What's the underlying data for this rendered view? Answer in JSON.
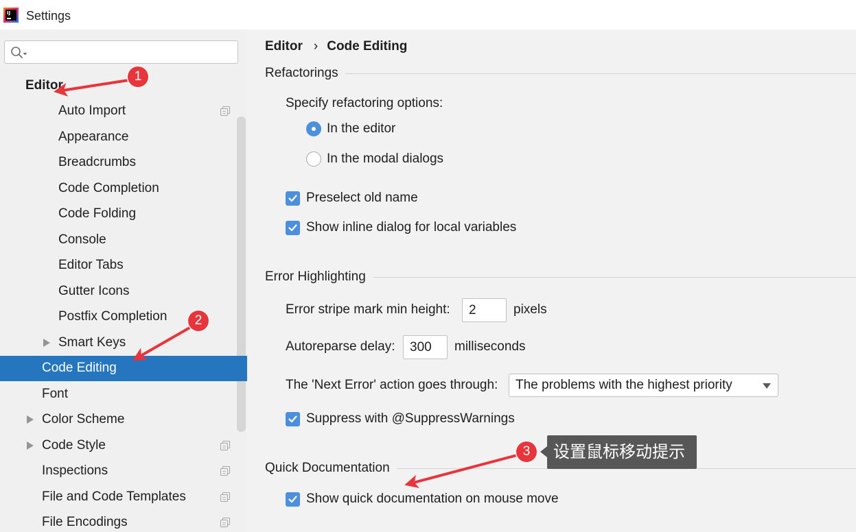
{
  "window": {
    "logo_text": "IJ",
    "title": "Settings"
  },
  "search": {
    "icon": "search-icon",
    "value": "",
    "placeholder": ""
  },
  "sidebar": {
    "items": [
      {
        "label": "Editor",
        "selected": false,
        "expandable": false
      },
      {
        "label": "Auto Import",
        "selected": false,
        "expandable": false,
        "icon": "project-scope-icon"
      },
      {
        "label": "Appearance",
        "selected": false,
        "expandable": false
      },
      {
        "label": "Breadcrumbs",
        "selected": false,
        "expandable": false
      },
      {
        "label": "Code Completion",
        "selected": false,
        "expandable": false
      },
      {
        "label": "Code Folding",
        "selected": false,
        "expandable": false
      },
      {
        "label": "Console",
        "selected": false,
        "expandable": false
      },
      {
        "label": "Editor Tabs",
        "selected": false,
        "expandable": false
      },
      {
        "label": "Gutter Icons",
        "selected": false,
        "expandable": false
      },
      {
        "label": "Postfix Completion",
        "selected": false,
        "expandable": false
      },
      {
        "label": "Smart Keys",
        "selected": false,
        "expandable": true
      },
      {
        "label": "Code Editing",
        "selected": true,
        "expandable": false
      },
      {
        "label": "Font",
        "selected": false,
        "expandable": false
      },
      {
        "label": "Color Scheme",
        "selected": false,
        "expandable": true
      },
      {
        "label": "Code Style",
        "selected": false,
        "expandable": true,
        "icon": "project-scope-icon"
      },
      {
        "label": "Inspections",
        "selected": false,
        "expandable": false,
        "icon": "project-scope-icon"
      },
      {
        "label": "File and Code Templates",
        "selected": false,
        "expandable": false,
        "icon": "project-scope-icon"
      },
      {
        "label": "File Encodings",
        "selected": false,
        "expandable": false,
        "icon": "project-scope-icon"
      }
    ]
  },
  "breadcrumb": {
    "items": [
      "Editor",
      "Code Editing"
    ],
    "separator": "›"
  },
  "refactorings": {
    "title": "Refactorings",
    "options_label": "Specify refactoring options:",
    "radios": [
      {
        "label": "In the editor",
        "checked": true
      },
      {
        "label": "In the modal dialogs",
        "checked": false
      }
    ],
    "checkboxes": [
      {
        "label": "Preselect old name",
        "checked": true
      },
      {
        "label": "Show inline dialog for local variables",
        "checked": true
      }
    ]
  },
  "error_highlighting": {
    "title": "Error Highlighting",
    "stripe_label": "Error stripe mark min height:",
    "stripe_value": "2",
    "stripe_unit": "pixels",
    "autoreparse_label": "Autoreparse delay:",
    "autoreparse_value": "300",
    "autoreparse_unit": "milliseconds",
    "next_error_label": "The 'Next Error' action goes through:",
    "next_error_selected": "The problems with the highest priority",
    "suppress": {
      "label": "Suppress with @SuppressWarnings",
      "checked": true
    }
  },
  "quick_documentation": {
    "title": "Quick Documentation",
    "show_on_mouse_move": {
      "label": "Show quick documentation on mouse move",
      "checked": true
    }
  },
  "annotations": {
    "markers": [
      "1",
      "2",
      "3"
    ],
    "tooltip": "设置鼠标移动提示"
  },
  "colors": {
    "selection": "#2675bf",
    "control_accent": "#4c8fdc",
    "annotation_red": "#e8353b",
    "tooltip_background": "#575757"
  }
}
